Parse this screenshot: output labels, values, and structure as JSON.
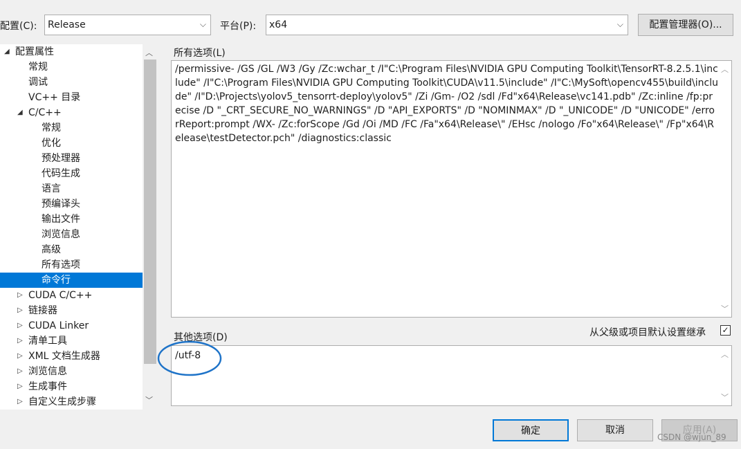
{
  "toolbar": {
    "config_label": "配置(C):",
    "config_value": "Release",
    "platform_label": "平台(P):",
    "platform_value": "x64",
    "manager_button": "配置管理器(O)..."
  },
  "tree": {
    "items": [
      "配置属性",
      "常规",
      "调试",
      "VC++ 目录",
      "C/C++",
      "常规",
      "优化",
      "预处理器",
      "代码生成",
      "语言",
      "预编译头",
      "输出文件",
      "浏览信息",
      "高级",
      "所有选项",
      "命令行",
      "CUDA C/C++",
      "链接器",
      "CUDA Linker",
      "清单工具",
      "XML 文档生成器",
      "浏览信息",
      "生成事件",
      "自定义生成步骤"
    ]
  },
  "all_options": {
    "label": "所有选项(L)",
    "text": "/permissive- /GS /GL /W3 /Gy /Zc:wchar_t /I\"C:\\Program Files\\NVIDIA GPU Computing Toolkit\\TensorRT-8.2.5.1\\include\" /I\"C:\\Program Files\\NVIDIA GPU Computing Toolkit\\CUDA\\v11.5\\include\" /I\"C:\\MySoft\\opencv455\\build\\include\" /I\"D:\\Projects\\yolov5_tensorrt-deploy\\yolov5\" /Zi /Gm- /O2 /sdl /Fd\"x64\\Release\\vc141.pdb\" /Zc:inline /fp:precise /D \"_CRT_SECURE_NO_WARNINGS\" /D \"API_EXPORTS\" /D \"NOMINMAX\" /D \"_UNICODE\" /D \"UNICODE\" /errorReport:prompt /WX- /Zc:forScope /Gd /Oi /MD /FC /Fa\"x64\\Release\\\" /EHsc /nologo /Fo\"x64\\Release\\\" /Fp\"x64\\Release\\testDetector.pch\" /diagnostics:classic"
  },
  "other_options": {
    "label": "其他选项(D)",
    "value": "/utf-8",
    "inherit_label": "从父级或项目默认设置继承",
    "inherit_checked": "✓"
  },
  "buttons": {
    "ok": "确定",
    "cancel": "取消",
    "apply": "应用(A)"
  },
  "watermark": "CSDN @wjun_89"
}
